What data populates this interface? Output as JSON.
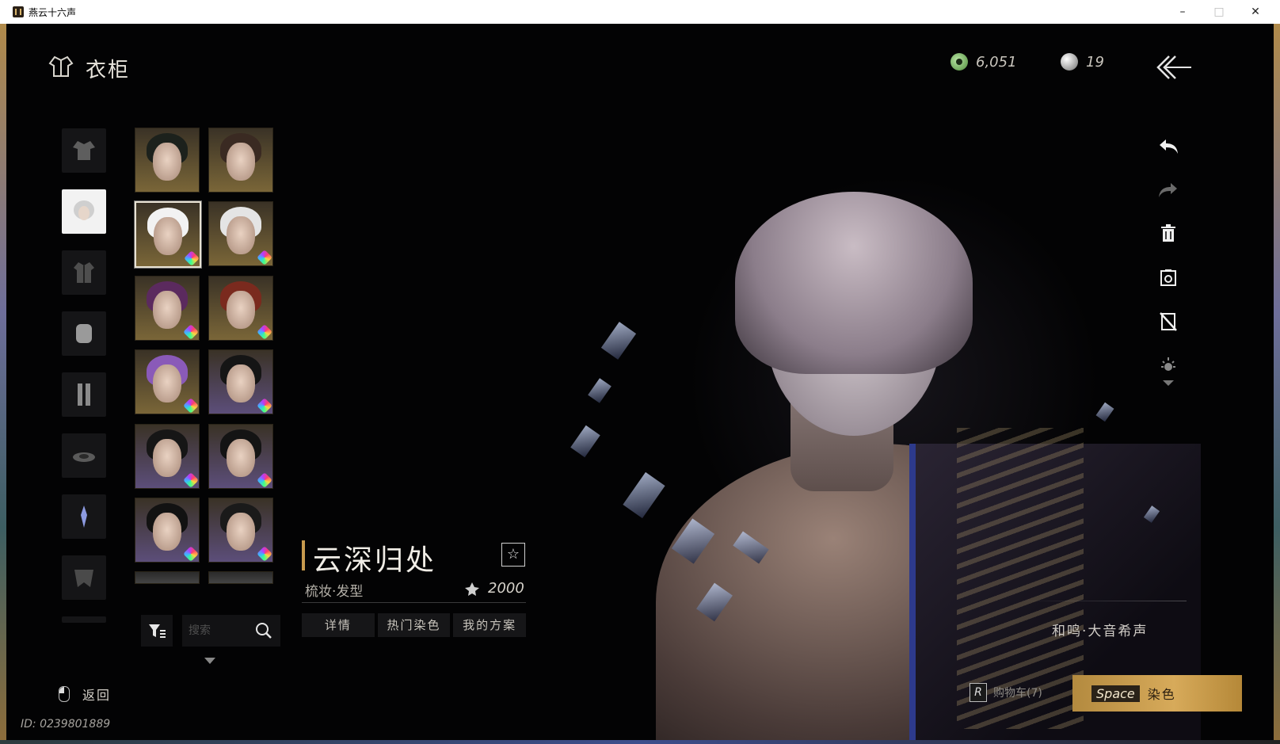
{
  "window": {
    "title": "燕云十六声",
    "minimize": "–",
    "maximize": "□",
    "close": "✕"
  },
  "header": {
    "title": "衣柜"
  },
  "currencies": [
    {
      "icon": "jade-coin-icon",
      "value": "6,051"
    },
    {
      "icon": "pearl-icon",
      "value": "19"
    }
  ],
  "categories": [
    {
      "icon": "robe-icon",
      "active": false
    },
    {
      "icon": "hairstyle-icon",
      "active": true
    },
    {
      "icon": "jacket-icon",
      "active": false
    },
    {
      "icon": "arm-wrap-icon",
      "active": false
    },
    {
      "icon": "leggings-icon",
      "active": false
    },
    {
      "icon": "hat-icon",
      "active": false
    },
    {
      "icon": "ornament-icon",
      "active": false
    },
    {
      "icon": "cape-icon",
      "active": false
    }
  ],
  "hair_tiles": [
    {
      "hair_color": "#1c211c",
      "bg": "gold",
      "dye": false,
      "selected": false
    },
    {
      "hair_color": "#3a2a22",
      "bg": "gold",
      "dye": false,
      "selected": false
    },
    {
      "hair_color": "#f2f2f2",
      "bg": "gold",
      "dye": true,
      "selected": true
    },
    {
      "hair_color": "#e4e4e4",
      "bg": "gold",
      "dye": true,
      "selected": false
    },
    {
      "hair_color": "#5b2a5e",
      "bg": "gold",
      "dye": true,
      "selected": false
    },
    {
      "hair_color": "#7a2a1e",
      "bg": "gold",
      "dye": true,
      "selected": false
    },
    {
      "hair_color": "#8a5ab8",
      "bg": "gold",
      "dye": true,
      "selected": false
    },
    {
      "hair_color": "#151515",
      "bg": "purple",
      "dye": true,
      "selected": false
    },
    {
      "hair_color": "#161616",
      "bg": "purple",
      "dye": true,
      "selected": false
    },
    {
      "hair_color": "#141414",
      "bg": "purple",
      "dye": true,
      "selected": false
    },
    {
      "hair_color": "#121212",
      "bg": "purple",
      "dye": true,
      "selected": false
    },
    {
      "hair_color": "#1a1a1a",
      "bg": "purple",
      "dye": true,
      "selected": false
    }
  ],
  "search": {
    "placeholder": "搜索"
  },
  "item": {
    "name": "云深归处",
    "category": "梳妆·发型",
    "price": "2000",
    "tabs": [
      "详情",
      "热门染色",
      "我的方案"
    ]
  },
  "toolbar": [
    "undo-icon",
    "redo-icon",
    "trash-icon",
    "camera-icon",
    "hide-icon",
    "light-icon"
  ],
  "weapon": {
    "name": "和鸣·大音希声"
  },
  "cart": {
    "key": "R",
    "label": "购物车(7)"
  },
  "dye_action": {
    "key": "Space",
    "label": "染色"
  },
  "return": {
    "label": "返回"
  },
  "player": {
    "id": "ID: 0239801889"
  },
  "colors": {
    "accent": "#c79a4e",
    "button_gold": "#d7aa5a",
    "tile_gold": "#7a6638",
    "tile_purple": "#5c4e7a"
  }
}
